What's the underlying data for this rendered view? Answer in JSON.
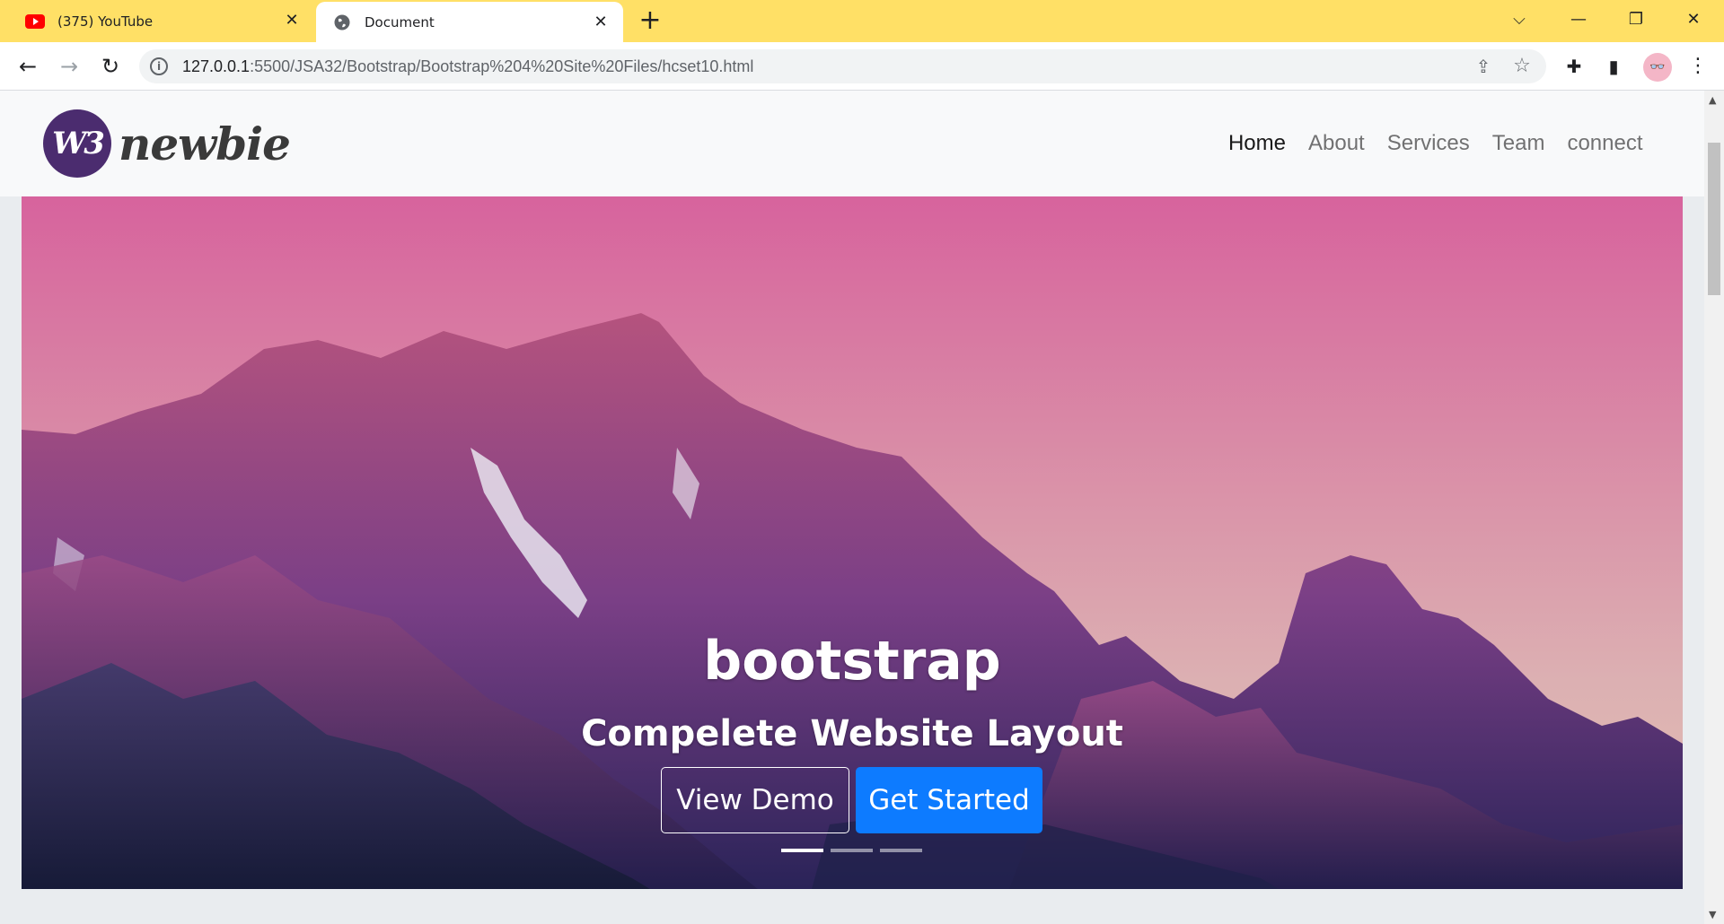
{
  "browser": {
    "tabs": [
      {
        "title": "(375) YouTube",
        "icon": "youtube-icon"
      },
      {
        "title": "Document",
        "icon": "globe-icon",
        "active": true
      }
    ],
    "url": {
      "host": "127.0.0.1",
      "path": ":5500/JSA32/Bootstrap/Bootstrap%204%20Site%20Files/hcset10.html"
    },
    "theme_color": "#ffe066"
  },
  "site": {
    "logo": {
      "mark": "W3",
      "word": "newbie"
    },
    "nav": [
      {
        "label": "Home",
        "active": true
      },
      {
        "label": "About"
      },
      {
        "label": "Services"
      },
      {
        "label": "Team"
      },
      {
        "label": "connect"
      }
    ],
    "hero": {
      "title": "bootstrap",
      "subtitle": "Compelete Website Layout",
      "buttons": {
        "demo": "View Demo",
        "start": "Get Started"
      },
      "slides": 3,
      "active_slide": 1,
      "primary_color": "#0d7bff"
    }
  }
}
